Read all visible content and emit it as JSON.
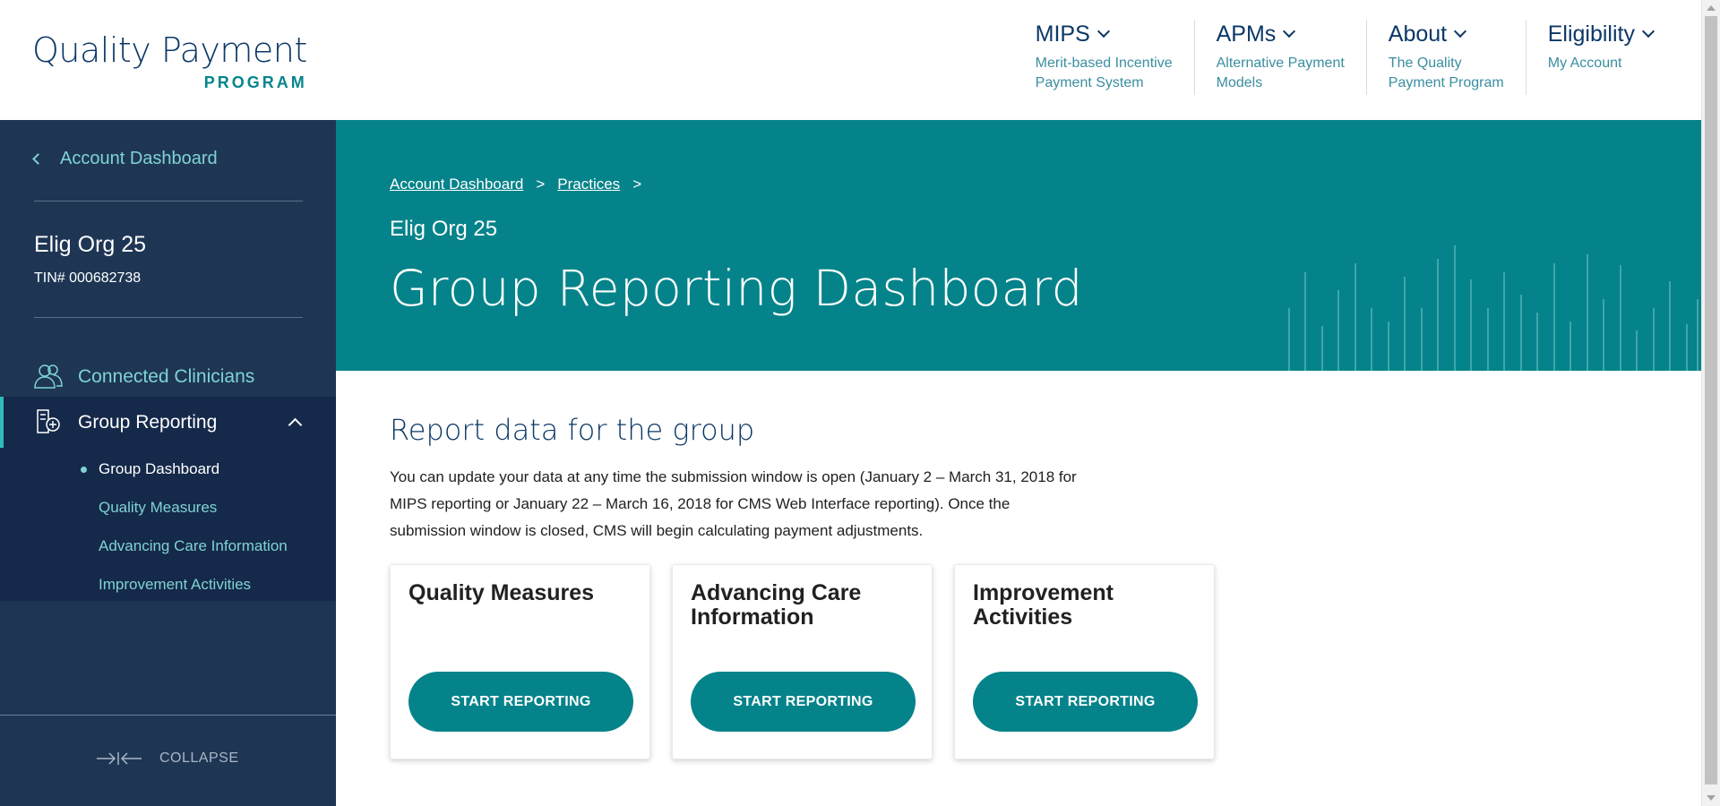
{
  "header": {
    "logo_main": "Quality Payment",
    "logo_sub": "PROGRAM",
    "nav": [
      {
        "title": "MIPS",
        "subtitle": "Merit-based Incentive\nPayment System"
      },
      {
        "title": "APMs",
        "subtitle": "Alternative Payment\nModels"
      },
      {
        "title": "About",
        "subtitle": "The Quality\nPayment Program"
      },
      {
        "title": "Eligibility",
        "subtitle": "My Account"
      }
    ]
  },
  "sidebar": {
    "back_label": "Account Dashboard",
    "org_name": "Elig Org 25",
    "tin": "TIN# 000682738",
    "connected_label": "Connected Clinicians",
    "group_reporting_label": "Group Reporting",
    "sub_items": [
      "Group Dashboard",
      "Quality Measures",
      "Advancing Care Information",
      "Improvement Activities"
    ],
    "collapse_label": "COLLAPSE"
  },
  "hero": {
    "breadcrumb": [
      "Account Dashboard",
      "Practices"
    ],
    "breadcrumb_separator": ">",
    "org": "Elig Org 25",
    "title": "Group Reporting Dashboard"
  },
  "main": {
    "section_title": "Report data for the group",
    "description": "You can update your data at any time the submission window is open (January 2 – March 31, 2018 for MIPS reporting or January 22 – March 16, 2018 for CMS Web Interface reporting). Once the submission window is closed, CMS will begin calculating payment adjustments.",
    "cards": [
      {
        "title": "Quality Measures",
        "button": "START REPORTING"
      },
      {
        "title": "Advancing Care Information",
        "button": "START REPORTING"
      },
      {
        "title": "Improvement Activities",
        "button": "START REPORTING"
      }
    ]
  },
  "colors": {
    "teal": "#05838a",
    "navy": "#1e3654",
    "navy_dark": "#15294a",
    "accent_text": "#7fd3d3",
    "title_blue": "#0b3866"
  }
}
